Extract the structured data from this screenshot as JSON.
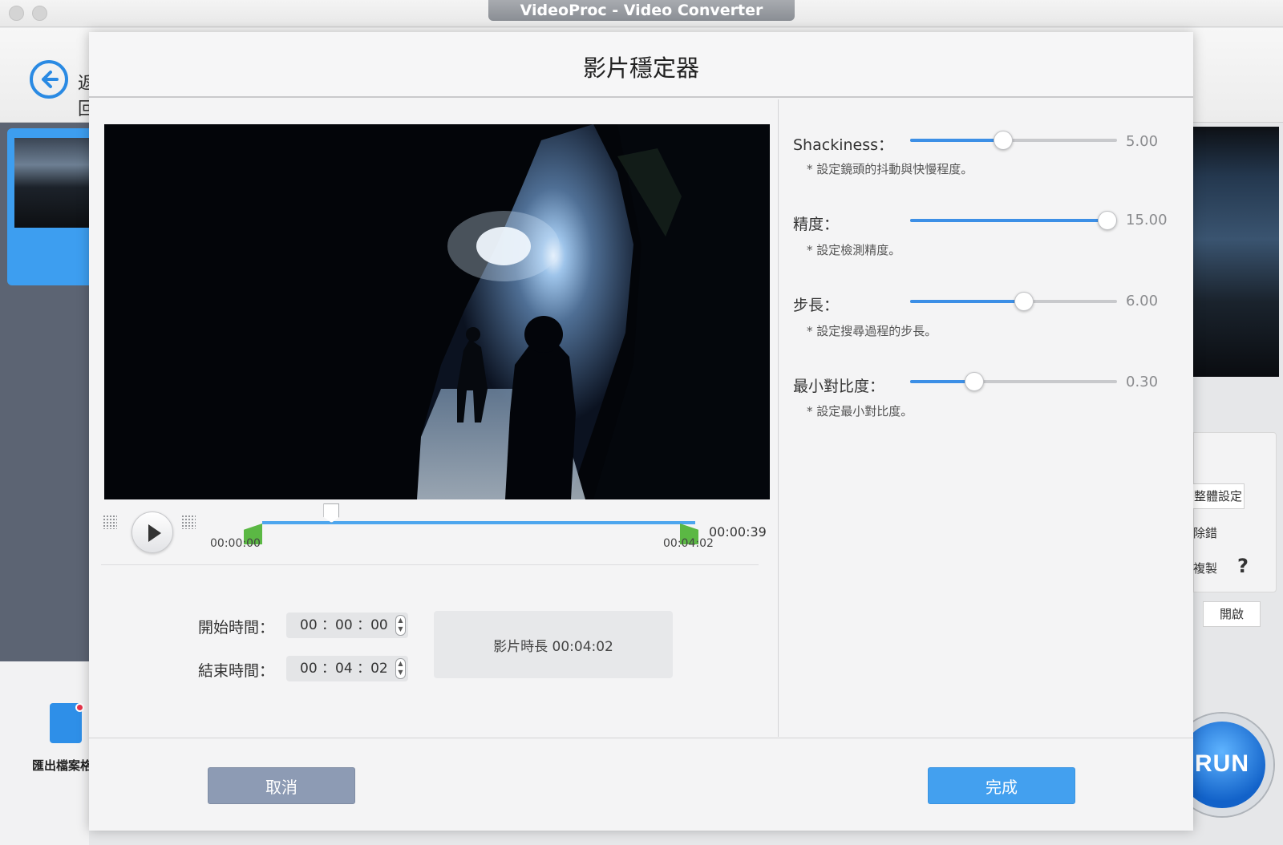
{
  "window": {
    "title": "VideoProc - Video Converter"
  },
  "background": {
    "back_label": "返回",
    "export_label": "匯出檔案格式",
    "right_button": "整體設定",
    "right_text1": "除錯",
    "right_text2": "複製",
    "help": "?",
    "open_button": "開啟",
    "run_label": "RUN"
  },
  "dialog": {
    "title": "影片穩定器",
    "timeline": {
      "start_label": "00:00:00",
      "end_label": "00:04:02",
      "current_time": "00:00:39",
      "playhead_fraction": 0.16
    },
    "start_time": {
      "label": "開始時間：",
      "value": "00 ：00 ：00"
    },
    "end_time": {
      "label": "結束時間：",
      "value": "00 ：04 ：02"
    },
    "duration": "影片時長   00:04:02",
    "settings": [
      {
        "label": "Shackiness：",
        "desc": "* 設定鏡頭的抖動與快慢程度。",
        "value": "5.00",
        "fraction": 0.45
      },
      {
        "label": "精度：",
        "desc": "* 設定檢測精度。",
        "value": "15.00",
        "fraction": 0.955
      },
      {
        "label": "步長：",
        "desc": "* 設定搜尋過程的步長。",
        "value": "6.00",
        "fraction": 0.55
      },
      {
        "label": "最小對比度：",
        "desc": "* 設定最小對比度。",
        "value": "0.30",
        "fraction": 0.31
      }
    ],
    "cancel_button": "取消",
    "done_button": "完成"
  },
  "colors": {
    "accent": "#43a0ef",
    "slider_fill": "#3c8fe6",
    "trim_handle": "#5bb844",
    "cancel": "#8d9bb4"
  }
}
